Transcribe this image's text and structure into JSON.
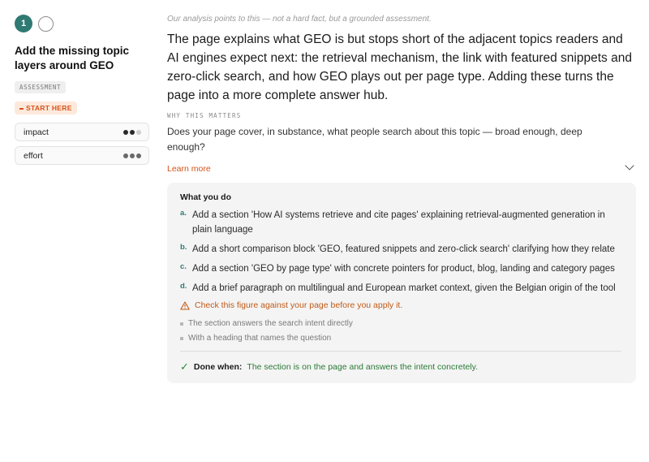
{
  "card": {
    "step_number": "1",
    "title": "Add the missing topic layers around GEO",
    "assessment_tag": "ASSESSMENT",
    "start_tag": "START HERE",
    "meters": [
      {
        "label": "impact",
        "level": 2,
        "max": 3
      },
      {
        "label": "effort",
        "level": 3,
        "max": 3
      }
    ]
  },
  "main": {
    "kicker": "Our analysis points to this — not a hard fact, but a grounded assessment.",
    "lead": "The page explains what GEO is but stops short of the adjacent topics readers and AI engines expect next: the retrieval mechanism, the link with featured snippets and zero-click search, and how GEO plays out per page type. Adding these turns the page into a more complete answer hub.",
    "why_heading": "WHY THIS MATTERS",
    "why_text": "Does your page cover, in substance, what people search about this topic — broad enough, deep enough?",
    "learn_more": "Learn more"
  },
  "actions": {
    "title": "What you do",
    "steps": [
      {
        "letter": "a.",
        "text": "Add a section 'How AI systems retrieve and cite pages' explaining retrieval-augmented generation in plain language"
      },
      {
        "letter": "b.",
        "text": "Add a short comparison block 'GEO, featured snippets and zero-click search' clarifying how they relate"
      },
      {
        "letter": "c.",
        "text": "Add a section 'GEO by page type' with concrete pointers for product, blog, landing and category pages"
      },
      {
        "letter": "d.",
        "text": "Add a brief paragraph on multilingual and European market context, given the Belgian origin of the tool"
      }
    ],
    "warning": "Check this figure against your page before you apply it.",
    "criteria": [
      "The section answers the search intent directly",
      "With a heading that names the question"
    ],
    "done_label": "Done when:",
    "done_text": "The section is on the page and answers the intent concretely."
  },
  "colors": {
    "accent": "#2f7a72",
    "orange": "#d4531a",
    "success": "#2a7a36"
  }
}
